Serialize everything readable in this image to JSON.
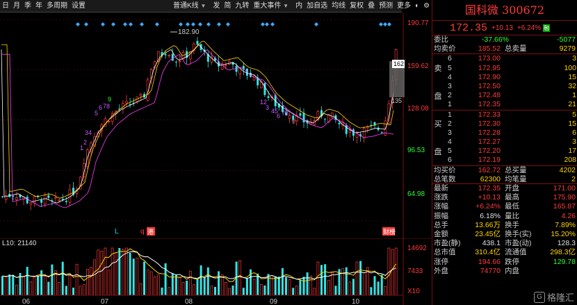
{
  "toolbar": {
    "left": [
      "日",
      "月",
      "季",
      "年",
      "多周期",
      "设置"
    ],
    "dropdown": "普通K线",
    "right": [
      "发",
      "简",
      "九转",
      "重大事件",
      "内",
      "加自选",
      "均线",
      "复权",
      "叠",
      "预测",
      "更多"
    ],
    "icons": [
      "toggle-icon",
      "settings-icon",
      "grid-icon",
      "search-icon",
      "expand-icon",
      "prev-next-icon"
    ]
  },
  "main_chart": {
    "price_labels": [
      "190.77",
      "159.62",
      "128.08",
      "96.53",
      "64.98"
    ],
    "high_label": "182.90",
    "marker_hi": "162",
    "marker_lo": "135",
    "bottom_tags": [
      "L",
      "q",
      "港",
      "财榜"
    ]
  },
  "vol_chart": {
    "label": "L10: 21140",
    "value_labels": [
      "14692",
      "7433",
      "X10"
    ],
    "months": [
      "06",
      "07",
      "08",
      "09",
      "10"
    ]
  },
  "panel": {
    "name": "国科微",
    "code": "300672",
    "price": "172.35",
    "change": "+10.13",
    "change_pct": "+6.24%",
    "tag": "融",
    "weibi": {
      "label": "委比",
      "pct": "-37.66%",
      "diff": "-5077"
    },
    "avg_sell": {
      "label": "均卖价",
      "value": "185.52",
      "label2": "总卖量",
      "value2": "9279"
    },
    "sell_side": "卖盘",
    "asks": [
      {
        "lvl": "6",
        "price": "173.00",
        "vol": "3"
      },
      {
        "lvl": "5",
        "price": "172.95",
        "vol": "100"
      },
      {
        "lvl": "4",
        "price": "172.90",
        "vol": "15"
      },
      {
        "lvl": "3",
        "price": "172.50",
        "vol": "32"
      },
      {
        "lvl": "2",
        "price": "172.48",
        "vol": "1"
      },
      {
        "lvl": "1",
        "price": "172.35",
        "vol": "21"
      }
    ],
    "buy_side": "买盘",
    "bids": [
      {
        "lvl": "1",
        "price": "172.33",
        "vol": "5"
      },
      {
        "lvl": "2",
        "price": "172.30",
        "vol": "15"
      },
      {
        "lvl": "3",
        "price": "172.28",
        "vol": "6"
      },
      {
        "lvl": "4",
        "price": "172.27",
        "vol": "3"
      },
      {
        "lvl": "5",
        "price": "172.20",
        "vol": "17"
      },
      {
        "lvl": "6",
        "price": "172.19",
        "vol": "208"
      }
    ],
    "avg_buy": {
      "label": "均买价",
      "value": "162.72",
      "label2": "总买量",
      "value2": "4202"
    },
    "total_trades": {
      "label": "总笔数",
      "value": "62300",
      "label2": "均笔量",
      "value2": "2"
    },
    "stats": [
      {
        "l1": "最新",
        "v1": "172.35",
        "c1": "red",
        "l2": "开盘",
        "v2": "171.00",
        "c2": "red"
      },
      {
        "l1": "涨跌",
        "v1": "+10.13",
        "c1": "red",
        "l2": "最高",
        "v2": "175.90",
        "c2": "red"
      },
      {
        "l1": "涨幅",
        "v1": "+6.24%",
        "c1": "red",
        "l2": "最低",
        "v2": "165.87",
        "c2": "red"
      },
      {
        "l1": "振幅",
        "v1": "6.18%",
        "c1": "white",
        "l2": "量比",
        "v2": "4.26",
        "c2": "red"
      },
      {
        "l1": "总手",
        "v1": "13.66万",
        "c1": "yellow",
        "l2": "换手",
        "v2": "7.89%",
        "c2": "yellow"
      },
      {
        "l1": "金额",
        "v1": "23.45亿",
        "c1": "yellow",
        "l2": "换手(实)",
        "v2": "15.20%",
        "c2": "yellow"
      },
      {
        "l1": "市盈(静)",
        "v1": "438.1",
        "c1": "white",
        "l2": "市盈(动)",
        "v2": "128.3",
        "c2": "white"
      },
      {
        "l1": "总市值",
        "v1": "310.4亿",
        "c1": "yellow",
        "l2": "流通值",
        "v2": "298.3亿",
        "c2": "yellow"
      },
      {
        "l1": "涨停",
        "v1": "194.66",
        "c1": "red",
        "l2": "跌停",
        "v2": "129.78",
        "c2": "green"
      },
      {
        "l1": "外盘",
        "v1": "74770",
        "c1": "red",
        "l2": "内盘",
        "v2": "",
        "c2": "green"
      }
    ],
    "watermark": "格隆汇"
  },
  "colors": {
    "up": "#ff3b3b",
    "down": "#33e5e5",
    "ma5": "#ffffff",
    "ma10": "#ffd600",
    "ma20": "#ff40ff",
    "accent_border": "#7a1010"
  }
}
